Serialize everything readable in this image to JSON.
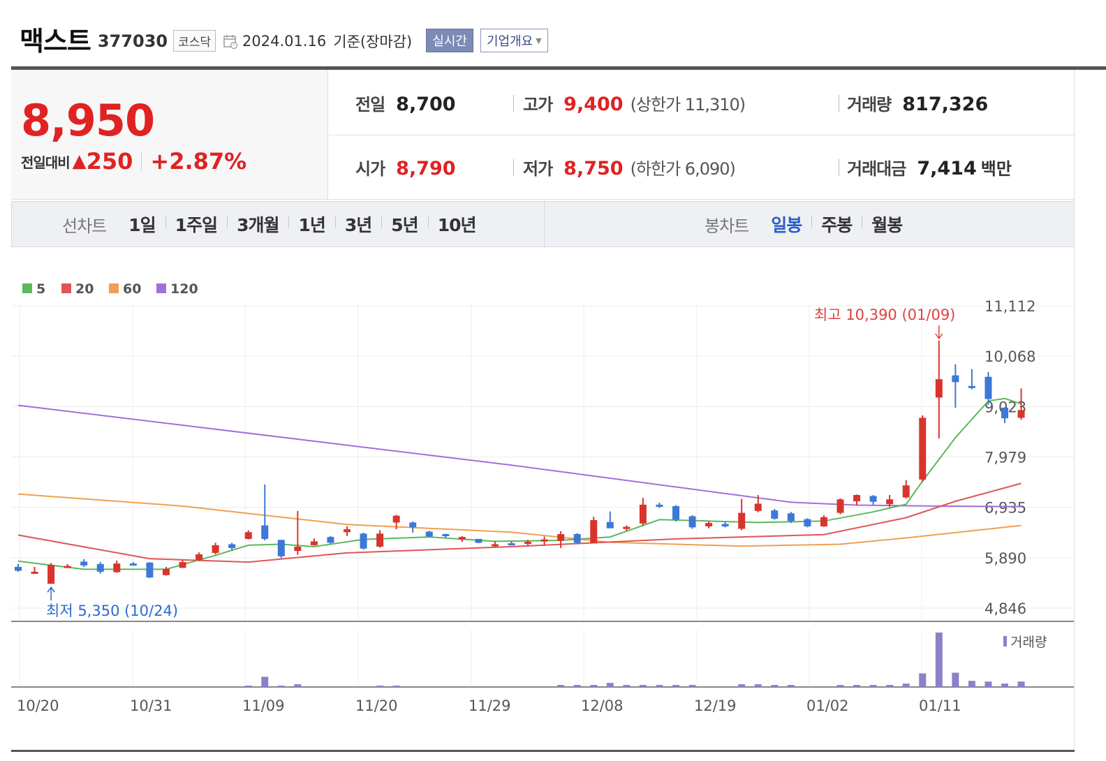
{
  "header": {
    "stock_name": "맥스트",
    "stock_code": "377030",
    "market": "코스닥",
    "date": "2024.01.16",
    "basis": "기준(장마감)",
    "realtime_label": "실시간",
    "company_label": "기업개요"
  },
  "price": {
    "current": "8,950",
    "change_label": "전일대비",
    "change_value": "250",
    "change_pct": "+2.87%"
  },
  "info": {
    "prev_close_label": "전일",
    "prev_close": "8,700",
    "high_label": "고가",
    "high": "9,400",
    "upper_limit": "(상한가 11,310)",
    "volume_label": "거래량",
    "volume": "817,326",
    "open_label": "시가",
    "open": "8,790",
    "low_label": "저가",
    "low": "8,750",
    "lower_limit": "(하한가 6,090)",
    "amount_label": "거래대금",
    "amount": "7,414",
    "amount_unit": "백만"
  },
  "line_chart_bar": {
    "title": "선차트",
    "items": [
      "1일",
      "1주일",
      "3개월",
      "1년",
      "3년",
      "5년",
      "10년"
    ]
  },
  "candle_chart_bar": {
    "title": "봉차트",
    "items": [
      "일봉",
      "주봉",
      "월봉"
    ],
    "active": "일봉"
  },
  "colors": {
    "up": "#d9342b",
    "down": "#3b78d8",
    "ma5": "#5cb85c",
    "ma20": "#e05555",
    "ma60": "#f0a050",
    "ma120": "#a070d8",
    "volume": "#8f7fc8"
  },
  "chart_data": {
    "type": "candlestick",
    "legend": [
      "5",
      "20",
      "60",
      "120"
    ],
    "y_ticks": [
      "11,112",
      "10,068",
      "9,023",
      "7,979",
      "6,935",
      "5,890",
      "4,846"
    ],
    "y_range": [
      4846,
      11112
    ],
    "x_ticks": [
      "10/20",
      "10/31",
      "11/09",
      "11/20",
      "11/29",
      "12/08",
      "12/19",
      "01/02",
      "01/11"
    ],
    "annotation_high": "최고 10,390 (01/09)",
    "annotation_low": "최저 5,350 (10/24)",
    "volume_label": "거래량",
    "candles": [
      {
        "o": 5700,
        "h": 5760,
        "l": 5600,
        "c": 5620
      },
      {
        "o": 5590,
        "h": 5700,
        "l": 5560,
        "c": 5600
      },
      {
        "o": 5350,
        "h": 5780,
        "l": 5350,
        "c": 5740
      },
      {
        "o": 5720,
        "h": 5760,
        "l": 5680,
        "c": 5720
      },
      {
        "o": 5810,
        "h": 5860,
        "l": 5700,
        "c": 5730
      },
      {
        "o": 5760,
        "h": 5800,
        "l": 5560,
        "c": 5600
      },
      {
        "o": 5590,
        "h": 5830,
        "l": 5580,
        "c": 5770
      },
      {
        "o": 5770,
        "h": 5800,
        "l": 5740,
        "c": 5760
      },
      {
        "o": 5790,
        "h": 5800,
        "l": 5470,
        "c": 5480
      },
      {
        "o": 5530,
        "h": 5700,
        "l": 5520,
        "c": 5660
      },
      {
        "o": 5680,
        "h": 5840,
        "l": 5680,
        "c": 5800
      },
      {
        "o": 5840,
        "h": 6000,
        "l": 5820,
        "c": 5960
      },
      {
        "o": 5990,
        "h": 6200,
        "l": 5960,
        "c": 6150
      },
      {
        "o": 6170,
        "h": 6200,
        "l": 6040,
        "c": 6090
      },
      {
        "o": 6280,
        "h": 6460,
        "l": 6270,
        "c": 6420
      },
      {
        "o": 6560,
        "h": 7410,
        "l": 6250,
        "c": 6280
      },
      {
        "o": 6260,
        "h": 6260,
        "l": 5880,
        "c": 5920
      },
      {
        "o": 6030,
        "h": 6860,
        "l": 5950,
        "c": 6120
      },
      {
        "o": 6150,
        "h": 6290,
        "l": 6140,
        "c": 6230
      },
      {
        "o": 6320,
        "h": 6340,
        "l": 6180,
        "c": 6200
      },
      {
        "o": 6420,
        "h": 6540,
        "l": 6340,
        "c": 6480
      },
      {
        "o": 6390,
        "h": 6410,
        "l": 6060,
        "c": 6080
      },
      {
        "o": 6120,
        "h": 6460,
        "l": 6100,
        "c": 6390
      },
      {
        "o": 6620,
        "h": 6780,
        "l": 6480,
        "c": 6760
      },
      {
        "o": 6620,
        "h": 6640,
        "l": 6410,
        "c": 6520
      },
      {
        "o": 6430,
        "h": 6450,
        "l": 6320,
        "c": 6330
      },
      {
        "o": 6380,
        "h": 6390,
        "l": 6300,
        "c": 6340
      },
      {
        "o": 6270,
        "h": 6340,
        "l": 6220,
        "c": 6320
      },
      {
        "o": 6280,
        "h": 6280,
        "l": 6190,
        "c": 6200
      },
      {
        "o": 6170,
        "h": 6230,
        "l": 6120,
        "c": 6170
      },
      {
        "o": 6190,
        "h": 6240,
        "l": 6150,
        "c": 6180
      },
      {
        "o": 6180,
        "h": 6260,
        "l": 6150,
        "c": 6220
      },
      {
        "o": 6250,
        "h": 6330,
        "l": 6140,
        "c": 6270
      },
      {
        "o": 6240,
        "h": 6440,
        "l": 6090,
        "c": 6380
      },
      {
        "o": 6380,
        "h": 6400,
        "l": 6170,
        "c": 6200
      },
      {
        "o": 6190,
        "h": 6740,
        "l": 6190,
        "c": 6670
      },
      {
        "o": 6630,
        "h": 6850,
        "l": 6560,
        "c": 6500
      },
      {
        "o": 6500,
        "h": 6560,
        "l": 6450,
        "c": 6530
      },
      {
        "o": 6600,
        "h": 7130,
        "l": 6550,
        "c": 6990
      },
      {
        "o": 6990,
        "h": 7030,
        "l": 6920,
        "c": 6960
      },
      {
        "o": 6960,
        "h": 6980,
        "l": 6640,
        "c": 6680
      },
      {
        "o": 6750,
        "h": 6770,
        "l": 6490,
        "c": 6520
      },
      {
        "o": 6540,
        "h": 6640,
        "l": 6500,
        "c": 6610
      },
      {
        "o": 6590,
        "h": 6630,
        "l": 6520,
        "c": 6540
      },
      {
        "o": 6490,
        "h": 7110,
        "l": 6460,
        "c": 6820
      },
      {
        "o": 6860,
        "h": 7190,
        "l": 6830,
        "c": 7010
      },
      {
        "o": 6870,
        "h": 6900,
        "l": 6680,
        "c": 6700
      },
      {
        "o": 6810,
        "h": 6840,
        "l": 6610,
        "c": 6650
      },
      {
        "o": 6690,
        "h": 6710,
        "l": 6520,
        "c": 6540
      },
      {
        "o": 6540,
        "h": 6770,
        "l": 6530,
        "c": 6730
      },
      {
        "o": 6820,
        "h": 7120,
        "l": 6790,
        "c": 7100
      },
      {
        "o": 7060,
        "h": 7200,
        "l": 6980,
        "c": 7190
      },
      {
        "o": 7170,
        "h": 7190,
        "l": 6980,
        "c": 7050
      },
      {
        "o": 7000,
        "h": 7190,
        "l": 6940,
        "c": 7100
      },
      {
        "o": 7140,
        "h": 7500,
        "l": 7120,
        "c": 7390
      },
      {
        "o": 7510,
        "h": 8840,
        "l": 7460,
        "c": 8790
      },
      {
        "o": 9210,
        "h": 10390,
        "l": 8360,
        "c": 9590
      },
      {
        "o": 9670,
        "h": 9900,
        "l": 9000,
        "c": 9530
      },
      {
        "o": 9450,
        "h": 9800,
        "l": 9380,
        "c": 9440
      },
      {
        "o": 9640,
        "h": 9740,
        "l": 9060,
        "c": 9180
      },
      {
        "o": 9000,
        "h": 9010,
        "l": 8680,
        "c": 8780
      },
      {
        "o": 8790,
        "h": 9400,
        "l": 8750,
        "c": 8950
      }
    ],
    "volumes": [
      0,
      0,
      0,
      0,
      0,
      0,
      0,
      0,
      0,
      0,
      0,
      0,
      0,
      0,
      2,
      15,
      2,
      4,
      0,
      0,
      0,
      0,
      2,
      2,
      0,
      0,
      0,
      0,
      0,
      0,
      0,
      0,
      0,
      3,
      3,
      3,
      6,
      3,
      3,
      3,
      3,
      3,
      0,
      0,
      4,
      4,
      3,
      3,
      0,
      0,
      3,
      3,
      3,
      3,
      5,
      20,
      80,
      21,
      9,
      8,
      5,
      8
    ],
    "ma120": [
      {
        "i": 0,
        "v": 9050
      },
      {
        "i": 30,
        "v": 7810
      },
      {
        "i": 47,
        "v": 7040
      },
      {
        "i": 51,
        "v": 6980
      },
      {
        "i": 56,
        "v": 6960
      },
      {
        "i": 61,
        "v": 6950
      }
    ],
    "ma60": [
      {
        "i": 0,
        "v": 7210
      },
      {
        "i": 10,
        "v": 6960
      },
      {
        "i": 20,
        "v": 6580
      },
      {
        "i": 30,
        "v": 6420
      },
      {
        "i": 36,
        "v": 6210
      },
      {
        "i": 44,
        "v": 6130
      },
      {
        "i": 50,
        "v": 6170
      },
      {
        "i": 54,
        "v": 6300
      },
      {
        "i": 61,
        "v": 6560
      }
    ],
    "ma20": [
      {
        "i": 0,
        "v": 6360
      },
      {
        "i": 8,
        "v": 5870
      },
      {
        "i": 14,
        "v": 5800
      },
      {
        "i": 20,
        "v": 5990
      },
      {
        "i": 30,
        "v": 6120
      },
      {
        "i": 40,
        "v": 6280
      },
      {
        "i": 49,
        "v": 6370
      },
      {
        "i": 54,
        "v": 6720
      },
      {
        "i": 57,
        "v": 7060
      },
      {
        "i": 61,
        "v": 7430
      }
    ],
    "ma5": [
      {
        "i": 0,
        "v": 5820
      },
      {
        "i": 4,
        "v": 5650
      },
      {
        "i": 9,
        "v": 5650
      },
      {
        "i": 12,
        "v": 5940
      },
      {
        "i": 14,
        "v": 6150
      },
      {
        "i": 16,
        "v": 6170
      },
      {
        "i": 18,
        "v": 6120
      },
      {
        "i": 21,
        "v": 6270
      },
      {
        "i": 25,
        "v": 6320
      },
      {
        "i": 29,
        "v": 6230
      },
      {
        "i": 33,
        "v": 6250
      },
      {
        "i": 36,
        "v": 6320
      },
      {
        "i": 39,
        "v": 6680
      },
      {
        "i": 42,
        "v": 6650
      },
      {
        "i": 45,
        "v": 6620
      },
      {
        "i": 49,
        "v": 6650
      },
      {
        "i": 52,
        "v": 6840
      },
      {
        "i": 54,
        "v": 7000
      },
      {
        "i": 55,
        "v": 7480
      },
      {
        "i": 57,
        "v": 8380
      },
      {
        "i": 59,
        "v": 9140
      },
      {
        "i": 60,
        "v": 9190
      },
      {
        "i": 61,
        "v": 9080
      }
    ]
  }
}
